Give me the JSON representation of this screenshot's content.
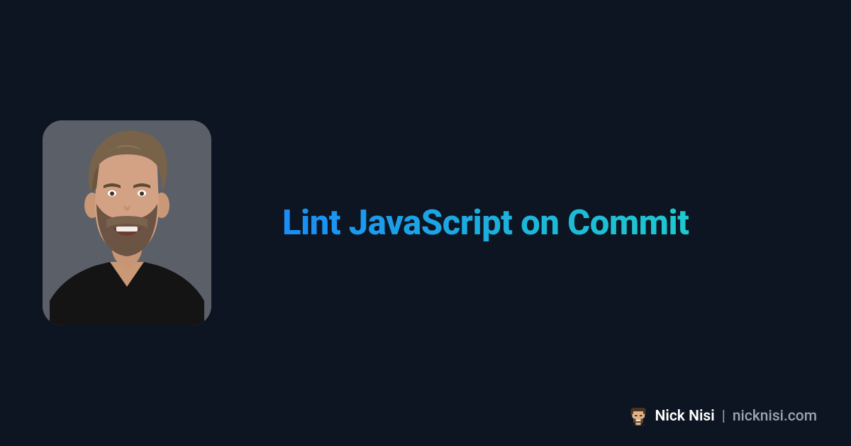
{
  "title": "Lint JavaScript on Commit",
  "footer": {
    "name": "Nick Nisi",
    "separator": "|",
    "domain": "nicknisi.com"
  }
}
